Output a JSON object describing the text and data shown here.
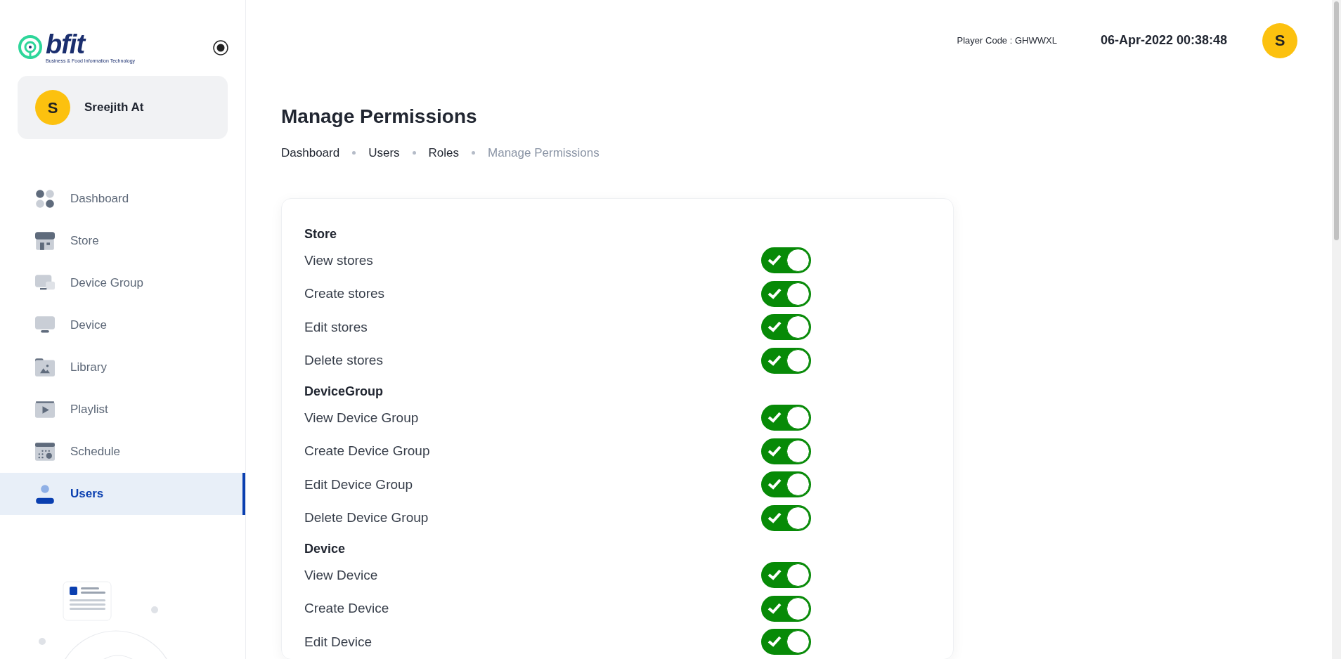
{
  "sidebar": {
    "logo": {
      "wordmark": "bfit",
      "tagline": "Business & Food Information Technology"
    },
    "user": {
      "initial": "S",
      "name": "Sreejith At"
    },
    "items": [
      {
        "label": "Dashboard",
        "selected": false
      },
      {
        "label": "Store",
        "selected": false
      },
      {
        "label": "Device Group",
        "selected": false
      },
      {
        "label": "Device",
        "selected": false
      },
      {
        "label": "Library",
        "selected": false
      },
      {
        "label": "Playlist",
        "selected": false
      },
      {
        "label": "Schedule",
        "selected": false
      },
      {
        "label": "Users",
        "selected": true
      }
    ]
  },
  "header": {
    "player_code": "Player Code : GHWWXL",
    "datetime": "06-Apr-2022 00:38:48",
    "avatar": "S"
  },
  "page": {
    "title": "Manage Permissions",
    "breadcrumbs": [
      {
        "label": "Dashboard",
        "current": false
      },
      {
        "label": "Users",
        "current": false
      },
      {
        "label": "Roles",
        "current": false
      },
      {
        "label": "Manage Permissions",
        "current": true
      }
    ]
  },
  "sections": [
    {
      "title": "Store",
      "permissions": [
        {
          "label": "View stores",
          "on": true
        },
        {
          "label": "Create stores",
          "on": true
        },
        {
          "label": "Edit stores",
          "on": true
        },
        {
          "label": "Delete stores",
          "on": true
        }
      ]
    },
    {
      "title": "DeviceGroup",
      "permissions": [
        {
          "label": "View Device Group",
          "on": true
        },
        {
          "label": "Create Device Group",
          "on": true
        },
        {
          "label": "Edit Device Group",
          "on": true
        },
        {
          "label": "Delete Device Group",
          "on": true
        }
      ]
    },
    {
      "title": "Device",
      "permissions": [
        {
          "label": "View Device",
          "on": true
        },
        {
          "label": "Create Device",
          "on": true
        },
        {
          "label": "Edit Device",
          "on": true
        }
      ]
    }
  ]
}
